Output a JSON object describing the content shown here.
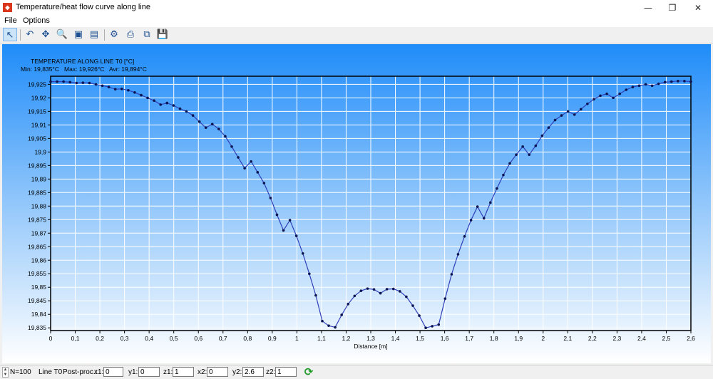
{
  "window": {
    "title": "Temperature/heat flow curve along line",
    "icon": "app-icon",
    "controls": {
      "minimize": "—",
      "maximize": "❐",
      "close": "✕"
    }
  },
  "menu": {
    "items": [
      "File",
      "Options"
    ]
  },
  "toolbar": {
    "buttons": [
      {
        "name": "select-icon",
        "glyph": "↖"
      },
      {
        "name": "undo-icon",
        "glyph": "↶"
      },
      {
        "name": "pan-icon",
        "glyph": "✥"
      },
      {
        "name": "zoom-icon",
        "glyph": "🔍"
      },
      {
        "name": "export-image-icon",
        "glyph": "▣"
      },
      {
        "name": "export-data-icon",
        "glyph": "▤"
      },
      {
        "name": "settings-icon",
        "glyph": "⚙"
      },
      {
        "name": "print-icon",
        "glyph": "⎙"
      },
      {
        "name": "copy-icon",
        "glyph": "⧉"
      },
      {
        "name": "save-icon",
        "glyph": "💾"
      }
    ]
  },
  "chart_header": {
    "title": "TEMPERATURE ALONG LINE T0 [°C]",
    "stats": "Min: 19,835°C   Max: 19,926°C   Avr: 19,894°C"
  },
  "chart_data": {
    "type": "line",
    "xlabel": "Distance [m]",
    "ylabel": "",
    "xlim": [
      0,
      2.6
    ],
    "ylim": [
      19.834,
      19.928
    ],
    "x_ticks": [
      "0",
      "0,1",
      "0,2",
      "0,3",
      "0,4",
      "0,5",
      "0,6",
      "0,7",
      "0,8",
      "0,9",
      "1",
      "1,1",
      "1,2",
      "1,3",
      "1,4",
      "1,5",
      "1,6",
      "1,7",
      "1,8",
      "1,9",
      "2",
      "2,1",
      "2,2",
      "2,3",
      "2,4",
      "2,5",
      "2,6"
    ],
    "y_ticks": [
      "19,925",
      "19,92",
      "19,915",
      "19,91",
      "19,905",
      "19,9",
      "19,895",
      "19,89",
      "19,885",
      "19,88",
      "19,875",
      "19,87",
      "19,865",
      "19,86",
      "19,855",
      "19,85",
      "19,845",
      "19,84",
      "19,835"
    ],
    "grid": true,
    "colors": {
      "line": "#2f3fb8",
      "marker": "#0c1550",
      "grid": "#ffffff",
      "axis": "#000000"
    },
    "series": [
      {
        "x": [
          0,
          0.0263,
          0.0525,
          0.0788,
          0.1051,
          0.1313,
          0.1576,
          0.1838,
          0.2101,
          0.2364,
          0.2626,
          0.2889,
          0.3152,
          0.3414,
          0.3677,
          0.3939,
          0.4202,
          0.4465,
          0.4727,
          0.499,
          0.5253,
          0.5515,
          0.5778,
          0.604,
          0.6303,
          0.6566,
          0.6828,
          0.7091,
          0.7354,
          0.7616,
          0.7879,
          0.8141,
          0.8404,
          0.8667,
          0.8929,
          0.9192,
          0.9455,
          0.9717,
          0.998,
          1.0242,
          1.0505,
          1.0768,
          1.103,
          1.1293,
          1.1556,
          1.1818,
          1.2081,
          1.2343,
          1.2606,
          1.2869,
          1.3131,
          1.3394,
          1.3657,
          1.3919,
          1.4182,
          1.4444,
          1.4707,
          1.497,
          1.5232,
          1.5495,
          1.5758,
          1.602,
          1.6283,
          1.6545,
          1.6808,
          1.7071,
          1.7333,
          1.7596,
          1.7859,
          1.8121,
          1.8384,
          1.8646,
          1.8909,
          1.9172,
          1.9434,
          1.9697,
          1.996,
          2.0222,
          2.0485,
          2.0747,
          2.101,
          2.1273,
          2.1535,
          2.1798,
          2.2061,
          2.2323,
          2.2586,
          2.2848,
          2.3111,
          2.3374,
          2.3636,
          2.3899,
          2.4162,
          2.4424,
          2.4687,
          2.4949,
          2.5212,
          2.5475,
          2.5737,
          2.6
        ],
        "values": [
          19.926,
          19.926,
          19.926,
          19.9258,
          19.9255,
          19.9256,
          19.9255,
          19.925,
          19.9245,
          19.924,
          19.9232,
          19.9233,
          19.9228,
          19.922,
          19.921,
          19.92,
          19.919,
          19.9175,
          19.9181,
          19.9172,
          19.916,
          19.915,
          19.9135,
          19.9112,
          19.909,
          19.9103,
          19.9085,
          19.9058,
          19.902,
          19.898,
          19.894,
          19.8965,
          19.8925,
          19.8885,
          19.883,
          19.8768,
          19.871,
          19.8748,
          19.869,
          19.8625,
          19.855,
          19.847,
          19.8375,
          19.8358,
          19.8352,
          19.8398,
          19.8438,
          19.8468,
          19.8487,
          19.8495,
          19.8492,
          19.8478,
          19.8493,
          19.8494,
          19.8485,
          19.8465,
          19.8432,
          19.8395,
          19.835,
          19.8356,
          19.8362,
          19.8458,
          19.8548,
          19.8622,
          19.8688,
          19.8748,
          19.8798,
          19.8755,
          19.8813,
          19.8865,
          19.8915,
          19.8958,
          19.899,
          19.902,
          19.899,
          19.9023,
          19.906,
          19.909,
          19.9118,
          19.9135,
          19.915,
          19.9138,
          19.9158,
          19.9178,
          19.9195,
          19.9208,
          19.9215,
          19.92,
          19.9215,
          19.923,
          19.924,
          19.9245,
          19.925,
          19.9245,
          19.9252,
          19.9258,
          19.926,
          19.9262,
          19.9262,
          19.926
        ]
      }
    ]
  },
  "statusbar": {
    "n_label": "N=100",
    "line_label": "Line T0",
    "postproc_label": "Post-proc.:",
    "fields": [
      {
        "label": "x1:",
        "value": "0"
      },
      {
        "label": "y1:",
        "value": "0"
      },
      {
        "label": "z1:",
        "value": "1"
      },
      {
        "label": "x2:",
        "value": "0"
      },
      {
        "label": "y2:",
        "value": "2.6"
      },
      {
        "label": "z2:",
        "value": "1"
      }
    ],
    "refresh_glyph": "⟳"
  }
}
